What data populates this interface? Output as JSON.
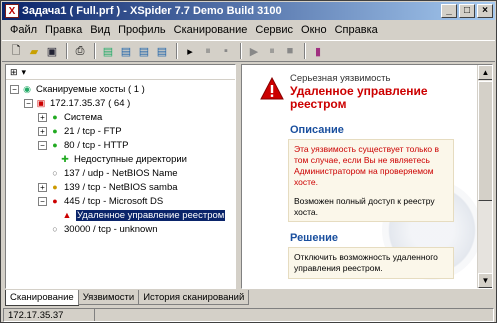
{
  "window": {
    "title": "Задача1 ( Full.prf ) - XSpider 7.7 Demo Build 3100"
  },
  "menu": [
    "Файл",
    "Правка",
    "Вид",
    "Профиль",
    "Сканирование",
    "Сервис",
    "Окно",
    "Справка"
  ],
  "tree": {
    "root": "Сканируемые хосты ( 1 )",
    "host": "172.17.35.37 ( 64 )",
    "items": [
      "Система",
      "21 / tcp - FTP",
      "80 / tcp - HTTP",
      "Недоступные директории",
      "137 / udp - NetBIOS Name",
      "139 / tcp - NetBIOS samba",
      "445 / tcp - Microsoft DS",
      "Удаленное управление реестром",
      "30000 / tcp - unknown"
    ]
  },
  "details": {
    "severity": "Серьезная уязвимость",
    "vuln_title": "Удаленное управление реестром",
    "desc_header": "Описание",
    "desc_text": "Эта уязвимость существует только в том случае, если Вы не являетесь Администратором на проверяемом хосте.",
    "desc_text2": "Возможен полный доступ к реестру хоста.",
    "solution_header": "Решение",
    "solution_text": "Отключить возможность удаленного управления реестром."
  },
  "tabs": [
    "Сканирование",
    "Уязвимости",
    "История сканирований"
  ],
  "status": {
    "host": "172.17.35.37"
  },
  "colors": {
    "accent": "#0a246a",
    "vuln_red": "#cc0000",
    "section_blue": "#1a4f9e"
  }
}
